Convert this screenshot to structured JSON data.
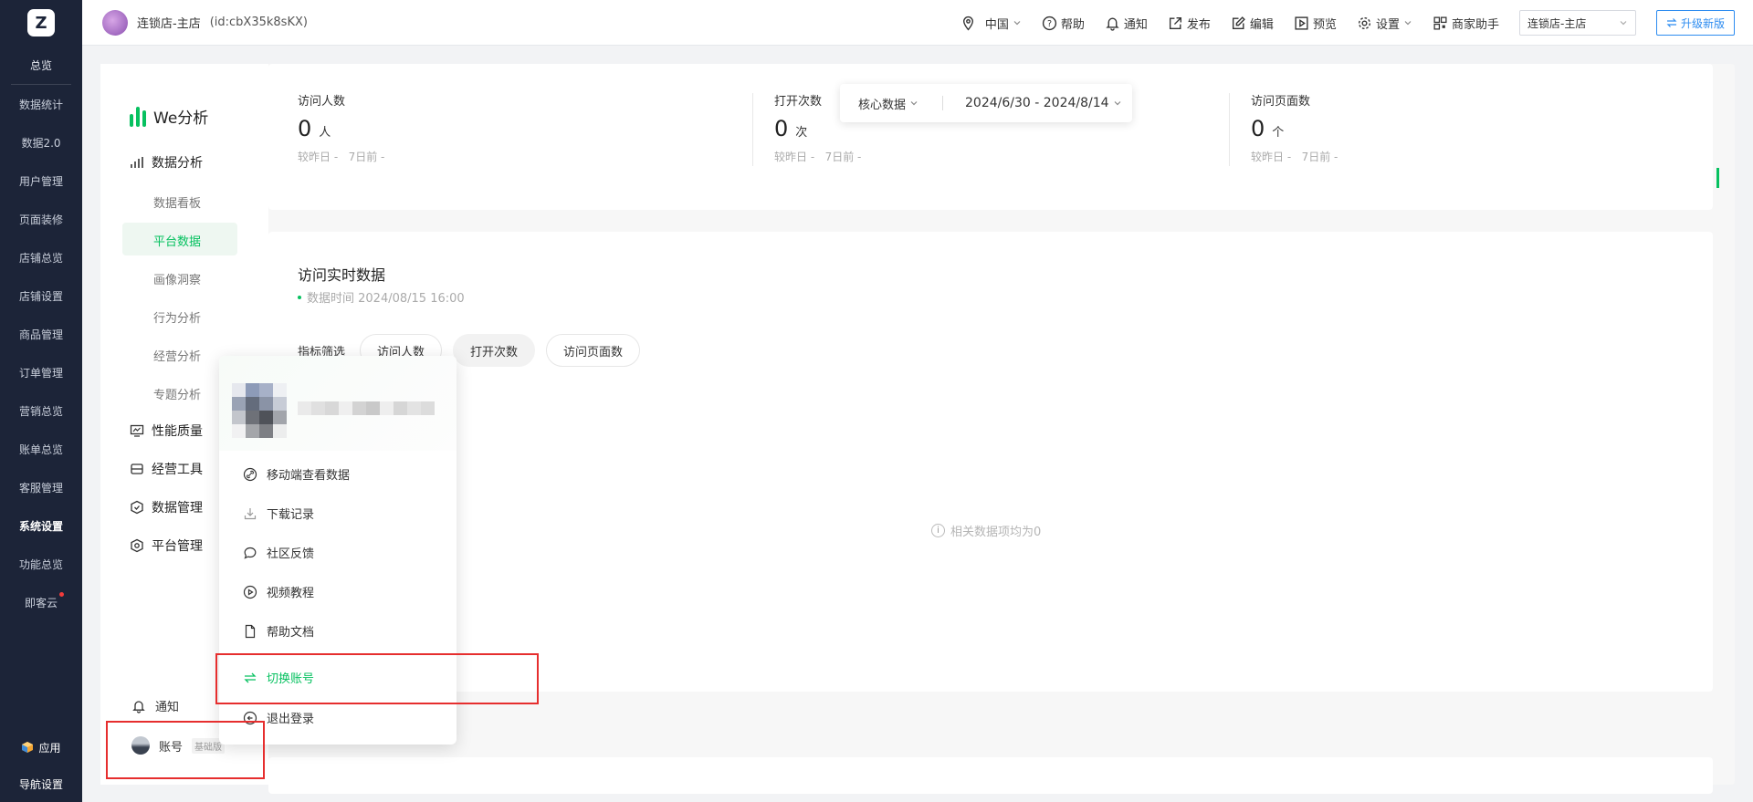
{
  "leftnav": {
    "logo": "Z",
    "overview": "总览",
    "items": [
      {
        "label": "数据统计"
      },
      {
        "label": "数据2.0"
      },
      {
        "label": "用户管理"
      },
      {
        "label": "页面装修"
      },
      {
        "label": "店铺总览"
      },
      {
        "label": "店铺设置"
      },
      {
        "label": "商品管理"
      },
      {
        "label": "订单管理"
      },
      {
        "label": "营销总览"
      },
      {
        "label": "账单总览"
      },
      {
        "label": "客服管理"
      },
      {
        "label": "系统设置"
      },
      {
        "label": "功能总览"
      },
      {
        "label": "即客云"
      }
    ],
    "apps": "应用",
    "nav_settings": "导航设置"
  },
  "topbar": {
    "store_name": "连锁店-主店",
    "store_id": "(id:cbX35k8sKX)",
    "region": "中国",
    "help": "帮助",
    "notify": "通知",
    "publish": "发布",
    "edit": "编辑",
    "preview": "预览",
    "settings": "设置",
    "assistant": "商家助手",
    "store_select": "连锁店-主店",
    "upgrade": "升级新版"
  },
  "sidenav": {
    "title": "We分析",
    "group_data_analysis": "数据分析",
    "subs": [
      "数据看板",
      "平台数据",
      "画像洞察",
      "行为分析",
      "经营分析",
      "专题分析"
    ],
    "group_perf": "性能质量",
    "group_tools": "经营工具",
    "group_data_mgmt": "数据管理",
    "group_platform": "平台管理",
    "notify": "通知",
    "account": "账号",
    "account_tag": "基础版"
  },
  "core": {
    "stats": [
      {
        "label": "访问人数",
        "value": "0",
        "unit": "人",
        "cmp_day": "较昨日 -",
        "cmp_week": "7日前 -"
      },
      {
        "label": "打开次数",
        "value": "0",
        "unit": "次",
        "cmp_day": "较昨日 -",
        "cmp_week": "7日前 -"
      },
      {
        "label": "访问页面数",
        "value": "0",
        "unit": "个",
        "cmp_day": "较昨日 -",
        "cmp_week": "7日前 -"
      }
    ],
    "filter_label": "核心数据",
    "date_range": "2024/6/30 - 2024/8/14"
  },
  "realtime": {
    "title": "访问实时数据",
    "time": "数据时间 2024/08/15 16:00",
    "filter_label": "指标筛选",
    "chips": [
      "访问人数",
      "打开次数",
      "访问页面数"
    ],
    "empty": "相关数据项均为0"
  },
  "popup": {
    "items": [
      "移动端查看数据",
      "下载记录",
      "社区反馈",
      "视频教程",
      "帮助文档",
      "切换账号",
      "退出登录"
    ]
  },
  "colors": {
    "nav_bg": "#1c2438",
    "accent": "#07c160",
    "highlight": "#e62e2e",
    "link": "#2d8cf0"
  }
}
